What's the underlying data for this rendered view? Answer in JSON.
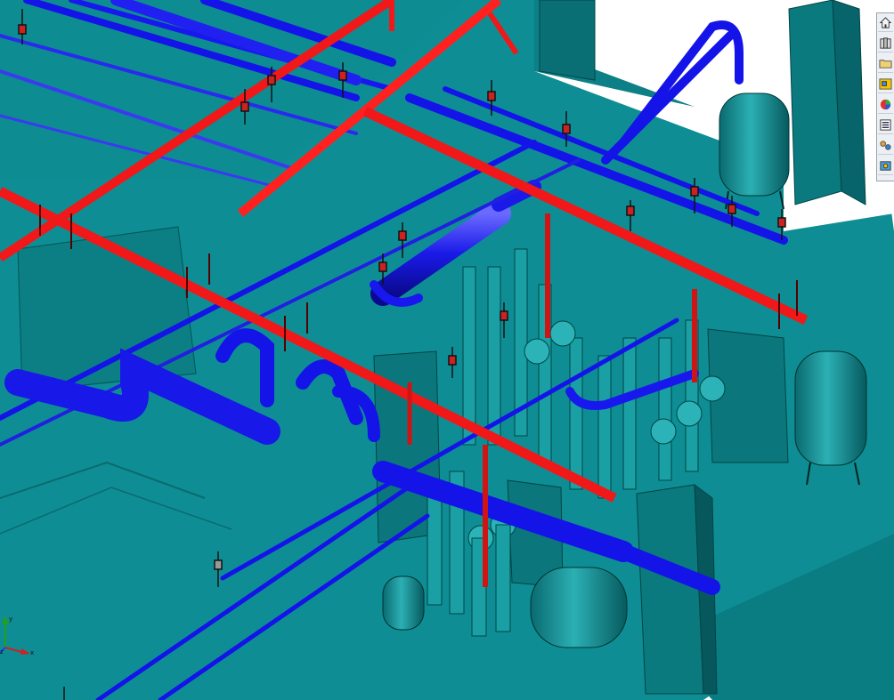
{
  "app": {
    "name": "3D CAD viewport"
  },
  "viewport": {
    "background_color": "#ffffff",
    "floor_color": "#0f8f95",
    "hot_pipe_color": "#f01818",
    "cold_pipe_color": "#1414e8",
    "equipment_color": "#0a7f84"
  },
  "task_pane": {
    "tabs": [
      {
        "icon": "home-icon"
      },
      {
        "icon": "design-library-icon"
      },
      {
        "icon": "file-explorer-icon"
      },
      {
        "icon": "view-palette-icon"
      },
      {
        "icon": "appearances-icon"
      },
      {
        "icon": "custom-properties-icon"
      },
      {
        "icon": "forum-icon"
      },
      {
        "icon": "recognition-icon"
      }
    ]
  },
  "reference_triad": {
    "axes": [
      "x",
      "y",
      "z"
    ]
  }
}
